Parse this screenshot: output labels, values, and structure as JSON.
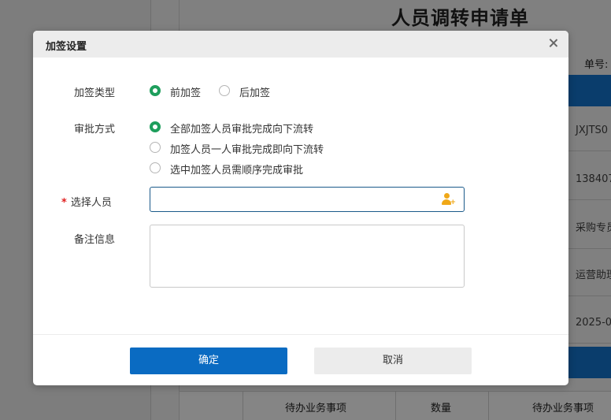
{
  "background": {
    "page_title": "人员调转申请单",
    "doc_no_label": "单号:",
    "cells": [
      "JXJTS0",
      "138407",
      "采购专员",
      "运营助理",
      "2025-0"
    ],
    "footer": {
      "col1": "待办业务事项",
      "col2": "数量",
      "col3": "待办业务事项"
    }
  },
  "dialog": {
    "title": "加签设置",
    "close_icon": "close-icon",
    "sign_type": {
      "label": "加签类型",
      "options": [
        {
          "label": "前加签",
          "checked": true
        },
        {
          "label": "后加签",
          "checked": false
        }
      ]
    },
    "approval_method": {
      "label": "审批方式",
      "options": [
        {
          "label": "全部加签人员审批完成向下流转",
          "checked": true
        },
        {
          "label": "加签人员一人审批完成即向下流转",
          "checked": false
        },
        {
          "label": "选中加签人员需顺序完成审批",
          "checked": false
        }
      ]
    },
    "select_person": {
      "required_mark": "*",
      "label": "选择人员",
      "value": "",
      "icon": "add-user-icon"
    },
    "remarks": {
      "label": "备注信息",
      "value": ""
    },
    "buttons": {
      "confirm": "确定",
      "cancel": "取消"
    }
  },
  "colors": {
    "accent_green": "#1e9e5c",
    "primary_blue": "#0a6bc2",
    "icon_orange": "#f0a818",
    "required_red": "#e02020"
  }
}
